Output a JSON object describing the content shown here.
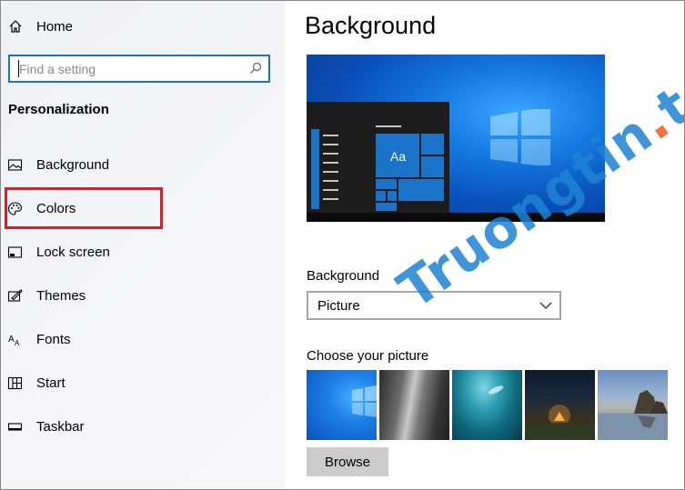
{
  "sidebar": {
    "home_label": "Home",
    "search": {
      "placeholder": "Find a setting",
      "value": ""
    },
    "section_title": "Personalization",
    "items": [
      {
        "label": "Background",
        "icon": "picture-icon"
      },
      {
        "label": "Colors",
        "icon": "palette-icon",
        "highlighted": true
      },
      {
        "label": "Lock screen",
        "icon": "lock-screen-icon"
      },
      {
        "label": "Themes",
        "icon": "themes-icon"
      },
      {
        "label": "Fonts",
        "icon": "fonts-icon"
      },
      {
        "label": "Start",
        "icon": "start-icon"
      },
      {
        "label": "Taskbar",
        "icon": "taskbar-icon"
      }
    ]
  },
  "main": {
    "title": "Background",
    "preview_tile_text": "Aa",
    "background_label": "Background",
    "background_select_value": "Picture",
    "choose_picture_label": "Choose your picture",
    "browse_label": "Browse"
  },
  "watermark": {
    "text_main": "Truongtin",
    "text_dot": ".",
    "text_tld": "top"
  },
  "colors": {
    "accent": "#1a73c8",
    "highlight_box": "#d61f26"
  }
}
